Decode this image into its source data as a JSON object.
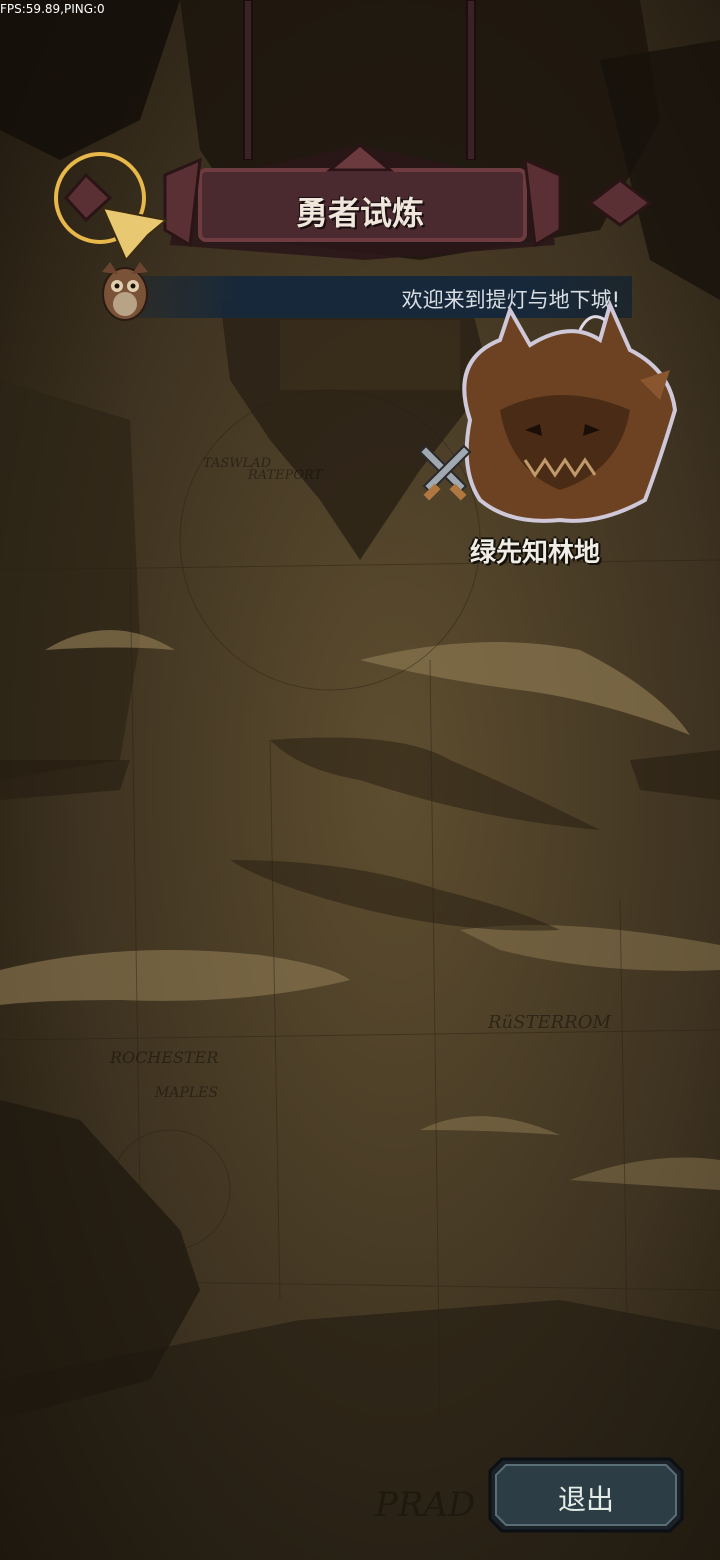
{
  "status": {
    "fps_text": "FPS:59.89,PING:0"
  },
  "header": {
    "title": "勇者试炼"
  },
  "message": {
    "text": "欢迎来到提灯与地下城!"
  },
  "location": {
    "name": "绿先知林地"
  },
  "map_labels": [
    "TASWLAD",
    "RATEPORT",
    "RüSTERROM",
    "ROCHESTER",
    "MAPLES",
    "PRAD"
  ],
  "buttons": {
    "exit_label": "退出"
  },
  "colors": {
    "accent_gold": "#e8b84a",
    "banner": "#4a2a2e",
    "exit_button": "#2c3d46"
  }
}
